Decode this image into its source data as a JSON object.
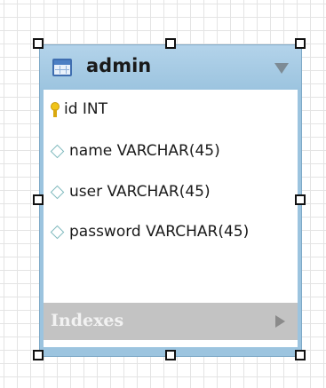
{
  "entity": {
    "title": "admin",
    "icon": "table-icon",
    "columns": [
      {
        "icon": "key-icon",
        "label": "id INT"
      },
      {
        "icon": "diamond-icon",
        "label": "name VARCHAR(45)"
      },
      {
        "icon": "diamond-icon",
        "label": "user VARCHAR(45)"
      },
      {
        "icon": "diamond-icon",
        "label": "password VARCHAR(45)"
      }
    ],
    "indexes_label": "Indexes"
  },
  "colors": {
    "header": "#9cc4df",
    "indexes_bar": "#c3c3c3",
    "key": "#f0c419",
    "column_diamond": "#7fb9bd"
  }
}
